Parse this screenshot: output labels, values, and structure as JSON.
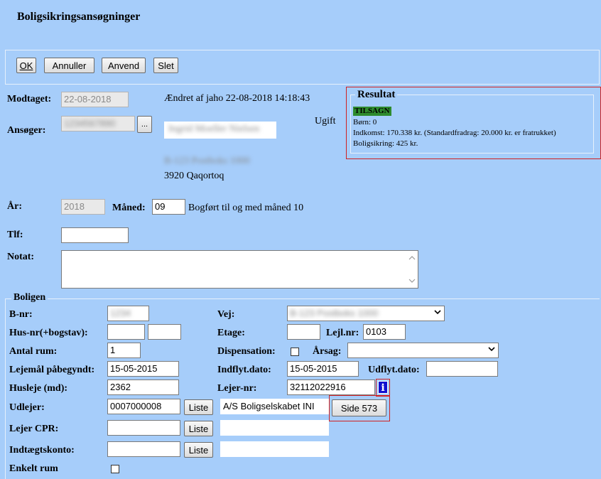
{
  "page_title": "Boligsikringsansøgninger",
  "toolbar": {
    "ok": "OK",
    "annuller": "Annuller",
    "anvend": "Anvend",
    "slet": "Slet"
  },
  "header": {
    "modtaget_label": "Modtaget:",
    "modtaget_value": "22-08-2018",
    "aendret": "Ændret af jaho 22-08-2018 14:18:43",
    "ansoeger_label": "Ansøger:",
    "ansoeger_value": "1234567890",
    "lookup_label": "...",
    "civil_status": "Ugift",
    "name": "Ingrid Moeller Nielsen",
    "address": "B-123 Postboks 1000",
    "city": "3920 Qaqortoq",
    "aar_label": "År:",
    "aar_value": "2018",
    "maaned_label": "Måned:",
    "maaned_value": "09",
    "bogfort": "Bogført til og med måned 10",
    "tlf_label": "Tlf:",
    "tlf_value": "",
    "notat_label": "Notat:",
    "notat_value": ""
  },
  "resultat": {
    "legend": "Resultat",
    "status": "TILSAGN",
    "boern": "Børn: 0",
    "indkomst": "Indkomst: 170.338 kr. (Standardfradrag: 20.000 kr. er fratrukket)",
    "boligsikring": "Boligsikring: 425 kr.",
    "status_color": "#2e8b2e"
  },
  "boligen": {
    "legend": "Boligen",
    "bnr_label": "B-nr:",
    "bnr_value": "1234",
    "vej_label": "Vej:",
    "vej_value": "B-123 Postboks 1000",
    "husnr_label": "Hus-nr(+bogstav):",
    "husnr_value": "",
    "husbogstav_value": "",
    "etage_label": "Etage:",
    "etage_value": "",
    "lejlnr_label": "Lejl.nr:",
    "lejlnr_value": "0103",
    "antal_rum_label": "Antal rum:",
    "antal_rum_value": "1",
    "dispensation_label": "Dispensation:",
    "aarsag_label": "Årsag:",
    "aarsag_value": "",
    "lejemaal_label": "Lejemål påbegyndt:",
    "lejemaal_value": "15-05-2015",
    "indflyt_label": "Indflyt.dato:",
    "indflyt_value": "15-05-2015",
    "udflyt_label": "Udflyt.dato:",
    "udflyt_value": "",
    "husleje_label": "Husleje (md):",
    "husleje_value": "2362",
    "lejernr_label": "Lejer-nr:",
    "lejernr_value": "32112022916",
    "info_label": "i",
    "udlejer_label": "Udlejer:",
    "udlejer_value": "0007000008",
    "liste_label": "Liste",
    "udlejer_name": "A/S Boligselskabet INI",
    "side_label": "Side 573",
    "lejer_cpr_label": "Lejer CPR:",
    "lejer_cpr_value": "",
    "lejer_cpr_name": "",
    "indtaegt_label": "Indtægtskonto:",
    "indtaegt_value": "",
    "indtaegt_name": "",
    "enkelt_rum_label": "Enkelt rum"
  }
}
